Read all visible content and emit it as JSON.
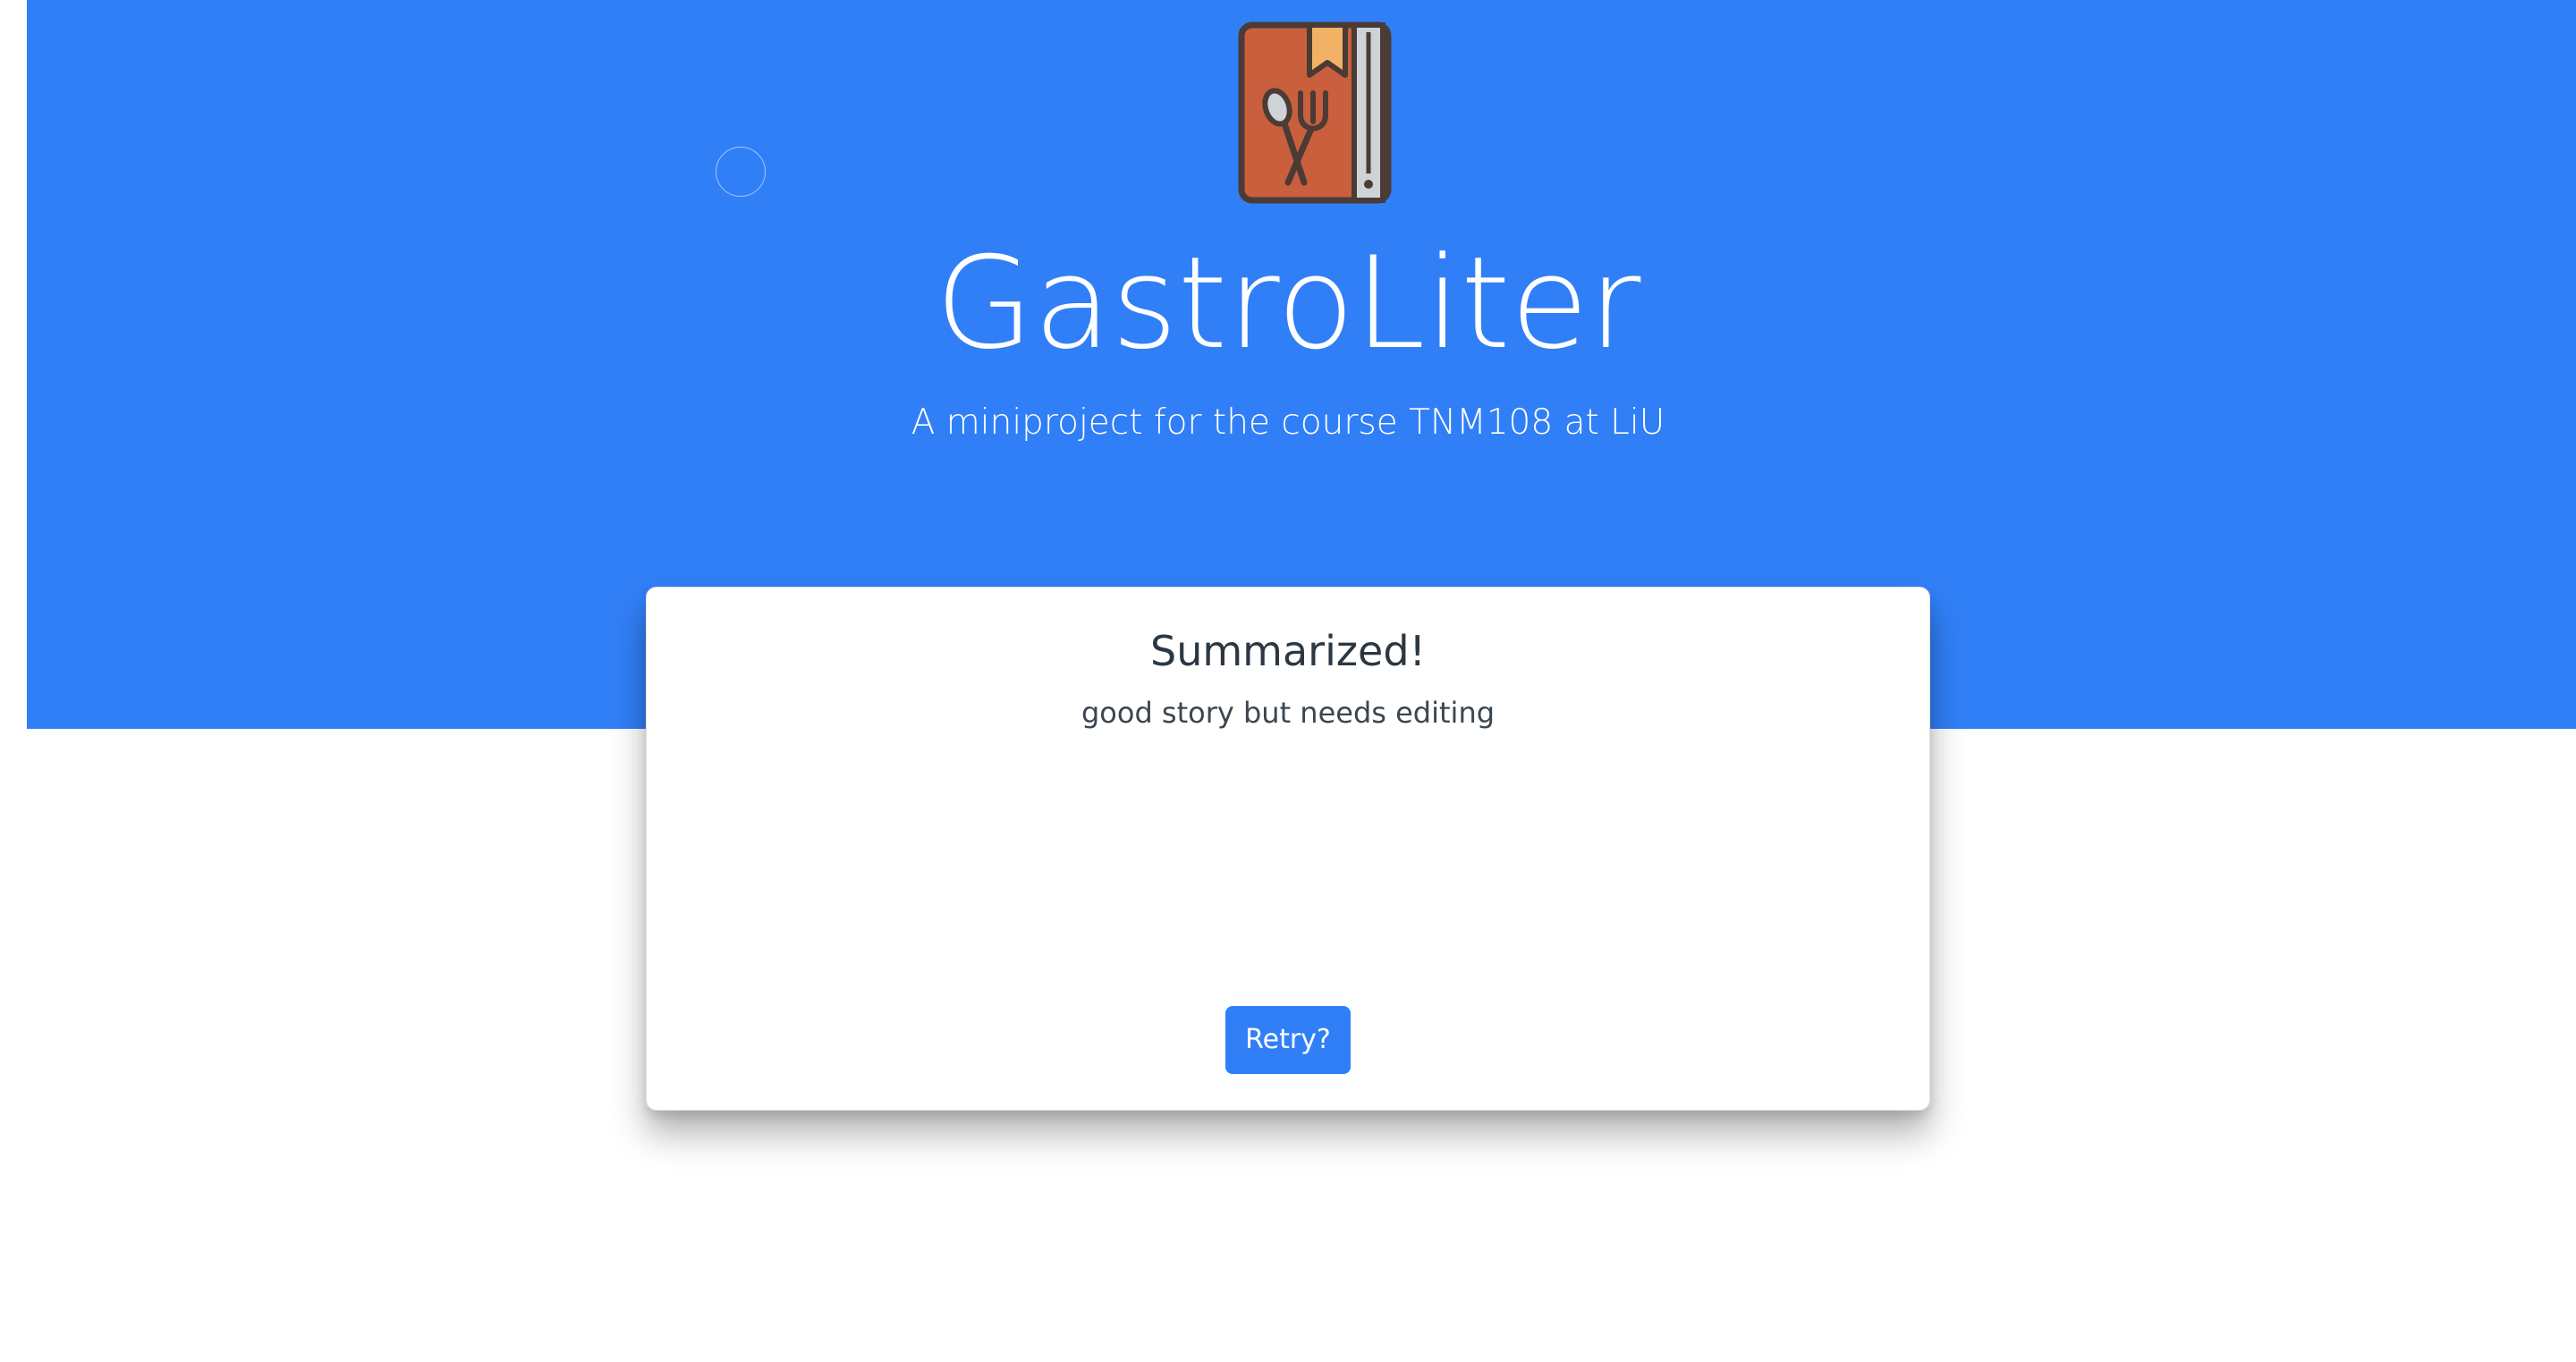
{
  "app": {
    "title": "GastroLiter",
    "subtitle": "A miniproject for the course TNM108 at LiU",
    "logo_icon": "recipe-book-icon"
  },
  "colors": {
    "brand_blue": "#317ff7",
    "book_cover": "#c95f3d",
    "bookmark": "#f2b266",
    "outline": "#4a3b35",
    "page_edge": "#cfd2d6"
  },
  "result_card": {
    "heading": "Summarized!",
    "summary": "good story but needs editing",
    "retry_label": "Retry?"
  }
}
